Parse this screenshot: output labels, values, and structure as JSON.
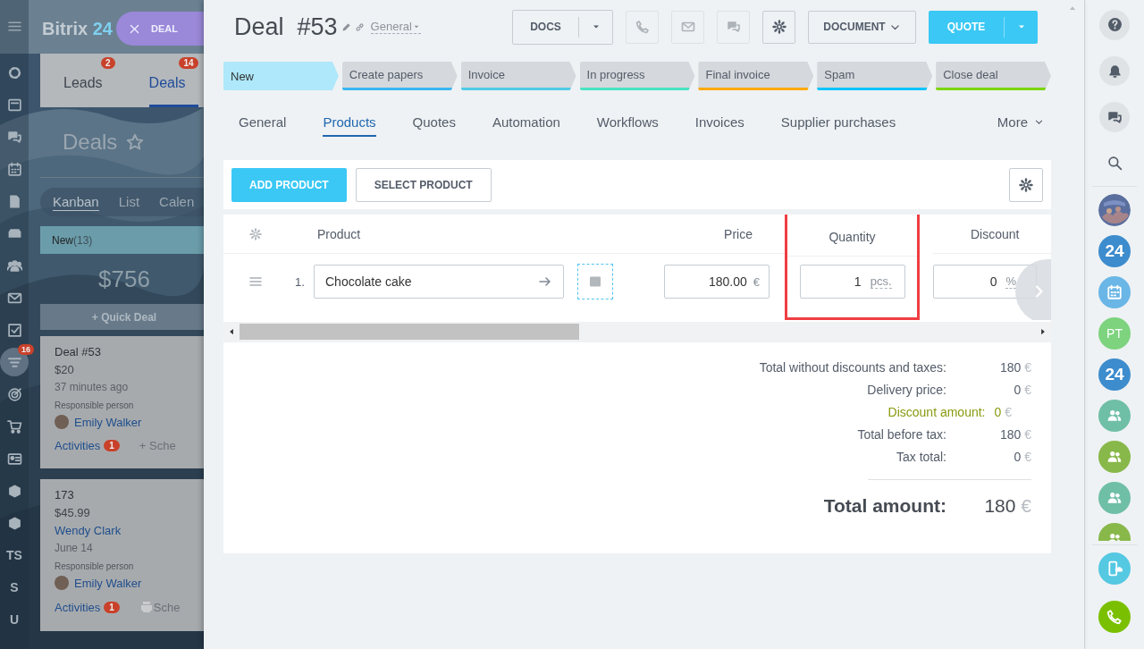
{
  "background": {
    "logo": {
      "name": "Bitrix",
      "suffix": "24"
    },
    "close_button": "DEAL",
    "sidebar": [
      {
        "kind": "activity",
        "selected": false
      },
      {
        "kind": "feed",
        "selected": false
      },
      {
        "kind": "chat",
        "selected": false
      },
      {
        "kind": "calendar",
        "selected": false
      },
      {
        "kind": "document",
        "selected": false
      },
      {
        "kind": "drive",
        "selected": false
      },
      {
        "kind": "people",
        "selected": false
      },
      {
        "kind": "mail",
        "selected": false
      },
      {
        "kind": "task",
        "selected": false
      },
      {
        "kind": "funnel",
        "selected": true,
        "badge": "16"
      },
      {
        "kind": "target",
        "selected": false
      },
      {
        "kind": "cart",
        "selected": false
      },
      {
        "kind": "contact",
        "selected": false
      },
      {
        "kind": "box",
        "selected": false
      },
      {
        "kind": "box",
        "selected": false
      },
      {
        "kind": "letter",
        "label": "TS",
        "selected": false
      },
      {
        "kind": "letter",
        "label": "S",
        "selected": false
      },
      {
        "kind": "letter",
        "label": "U",
        "selected": false
      }
    ],
    "tabs": [
      {
        "label": "Leads",
        "badge": "2",
        "selected": false
      },
      {
        "label": "Deals",
        "badge": "14",
        "selected": true
      }
    ],
    "title": "Deals",
    "views": [
      {
        "label": "Kanban",
        "selected": true
      },
      {
        "label": "List",
        "selected": false
      },
      {
        "label": "Calen",
        "selected": false
      }
    ],
    "column": {
      "name": "New",
      "count": "(13)",
      "total": "$756",
      "quick_deal": "+ Quick Deal"
    },
    "cards": [
      {
        "title": "Deal #53",
        "amount": "$20",
        "meta": "37 minutes ago",
        "role": "Responsible person",
        "person": "Emily Walker",
        "activities": "Activities",
        "activity_count": "1",
        "schedule": "+ Sche",
        "printer": false
      },
      {
        "title": "173",
        "amount": "$45.99",
        "meta": "June 14",
        "contact": "Wendy Clark",
        "role": "Responsible person",
        "person": "Emily Walker",
        "activities": "Activities",
        "activity_count": "1",
        "schedule": "Sche",
        "printer": true
      }
    ]
  },
  "deal": {
    "title": "Deal",
    "number": "#53",
    "category": "General",
    "toolbar": {
      "docs": "DOCS",
      "document": "DOCUMENT",
      "quote": "QUOTE"
    },
    "stages": [
      {
        "label": "New",
        "color": "#aee8fa",
        "selected": true
      },
      {
        "label": "Create papers",
        "color": "#39b7f2",
        "selected": false
      },
      {
        "label": "Invoice",
        "color": "#4fcbe6",
        "selected": false
      },
      {
        "label": "In progress",
        "color": "#47e4c2",
        "selected": false
      },
      {
        "label": "Final invoice",
        "color": "#ffa900",
        "selected": false
      },
      {
        "label": "Spam",
        "color": "#00c4fb",
        "selected": false
      },
      {
        "label": "Close deal",
        "color": "#7bd500",
        "selected": false
      }
    ],
    "tabs": [
      {
        "label": "General",
        "selected": false
      },
      {
        "label": "Products",
        "selected": true
      },
      {
        "label": "Quotes",
        "selected": false
      },
      {
        "label": "Automation",
        "selected": false
      },
      {
        "label": "Workflows",
        "selected": false
      },
      {
        "label": "Invoices",
        "selected": false
      },
      {
        "label": "Supplier purchases",
        "selected": false
      }
    ],
    "more": "More",
    "products": {
      "add_button": "ADD PRODUCT",
      "select_button": "SELECT PRODUCT",
      "columns": [
        {
          "kind": "handle"
        },
        {
          "kind": "product",
          "label": "Product"
        },
        {
          "kind": "price",
          "label": "Price"
        },
        {
          "kind": "quantity",
          "label": "Quantity",
          "highlighted": true
        },
        {
          "kind": "discount",
          "label": "Discount"
        }
      ],
      "rows": [
        {
          "number": "1.",
          "product": "Chocolate cake",
          "price": "180.00",
          "price_unit": "€",
          "quantity": "1",
          "quantity_unit": "pcs.",
          "discount": "0",
          "discount_unit": "%"
        }
      ],
      "totals": [
        {
          "kind": "normal",
          "label": "Total without discounts and taxes:",
          "value": "180",
          "currency": "€"
        },
        {
          "kind": "normal",
          "label": "Delivery price:",
          "value": "0",
          "currency": "€"
        },
        {
          "kind": "discount",
          "label": "Discount amount:",
          "value": "0",
          "currency": "€"
        },
        {
          "kind": "normal",
          "label": "Total before tax:",
          "value": "180",
          "currency": "€"
        },
        {
          "kind": "normal",
          "label": "Tax total:",
          "value": "0",
          "currency": "€"
        }
      ],
      "grand_total": {
        "label": "Total amount:",
        "value": "180",
        "currency": "€"
      }
    }
  },
  "right_bar": {
    "tools": [
      {
        "kind": "help"
      },
      {
        "kind": "bell"
      },
      {
        "kind": "chat"
      },
      {
        "kind": "search"
      }
    ],
    "contacts": [
      {
        "kind": "picture",
        "color": "#5a6f9e"
      },
      {
        "kind": "text",
        "label": "24",
        "color": "#3d8ccd"
      },
      {
        "kind": "calendar",
        "color": "#6ab6e6"
      },
      {
        "kind": "text",
        "label": "PT",
        "color": "#7dd37e"
      },
      {
        "kind": "text",
        "label": "24",
        "color": "#3d8ccd"
      },
      {
        "kind": "group",
        "color": "#6fbfa6"
      },
      {
        "kind": "group",
        "color": "#88b84a"
      },
      {
        "kind": "group",
        "color": "#6fbfa6"
      },
      {
        "kind": "group",
        "color": "#88b84a"
      }
    ],
    "calls": [
      {
        "kind": "phone-cloud",
        "color": "#55c8e2"
      },
      {
        "kind": "phone",
        "color": "#7ac000"
      }
    ]
  }
}
